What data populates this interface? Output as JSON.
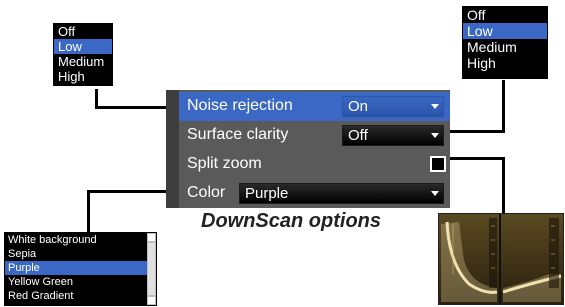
{
  "noise_popup": {
    "options": [
      "Off",
      "Low",
      "Medium",
      "High"
    ],
    "selected": 1
  },
  "clarity_popup": {
    "options": [
      "Off",
      "Low",
      "Medium",
      "High"
    ],
    "selected": 1
  },
  "menu": {
    "noise": {
      "label": "Noise rejection",
      "value": "On"
    },
    "clarity": {
      "label": "Surface clarity",
      "value": "Off"
    },
    "split": {
      "label": "Split zoom",
      "checked": false
    },
    "color": {
      "label": "Color",
      "value": "Purple"
    }
  },
  "color_popup": {
    "options": [
      "White background",
      "Sepia",
      "Purple",
      "Yellow Green",
      "Red Gradient"
    ],
    "selected": 2
  },
  "caption": "DownScan options",
  "colors": {
    "highlight": "#3a68c4",
    "menu_bg": "#5a5a5a",
    "sonar_bg": "#3a2e16"
  }
}
